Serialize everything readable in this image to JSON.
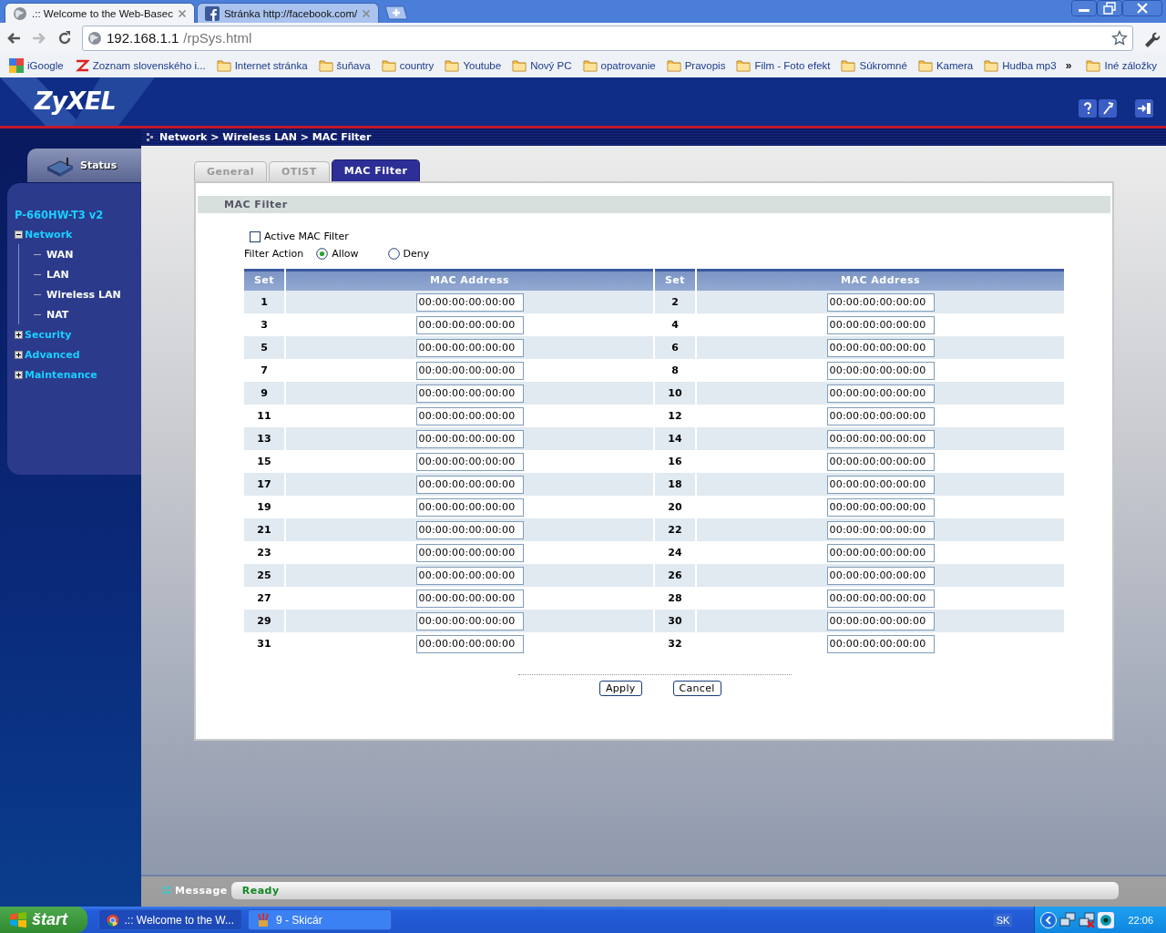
{
  "browser": {
    "tabs": [
      {
        "title": ".:: Welcome to the Web-Basec",
        "kind": "globe",
        "selected": true
      },
      {
        "title": "Stránka http://facebook.com/",
        "kind": "facebook",
        "selected": false
      }
    ],
    "address": {
      "host": "192.168.1.1",
      "path": "/rpSys.html"
    },
    "bookmarks": [
      {
        "label": "iGoogle",
        "kind": "google"
      },
      {
        "label": "Zoznam slovenského i...",
        "kind": "zoznam"
      },
      {
        "label": "Internet stránka",
        "kind": "folder"
      },
      {
        "label": "šuňava",
        "kind": "folder"
      },
      {
        "label": "country",
        "kind": "folder"
      },
      {
        "label": "Youtube",
        "kind": "folder"
      },
      {
        "label": "Nový PC",
        "kind": "folder"
      },
      {
        "label": "opatrovanie",
        "kind": "folder"
      },
      {
        "label": "Pravopis",
        "kind": "folder"
      },
      {
        "label": "Film - Foto efekt",
        "kind": "folder"
      },
      {
        "label": "Súkromné",
        "kind": "folder"
      },
      {
        "label": "Kamera",
        "kind": "folder"
      },
      {
        "label": "Hudba mp3",
        "kind": "folder"
      }
    ],
    "overflow": "»",
    "other_bookmarks": "Iné záložky"
  },
  "router": {
    "logo": "ZyXEL",
    "status_tab": "Status",
    "model": "P-660HW-T3 v2",
    "nav": [
      {
        "label": "Network",
        "expanded": true,
        "children": [
          {
            "label": "WAN"
          },
          {
            "label": "LAN"
          },
          {
            "label": "Wireless LAN"
          },
          {
            "label": "NAT"
          }
        ]
      },
      {
        "label": "Security",
        "expanded": false
      },
      {
        "label": "Advanced",
        "expanded": false
      },
      {
        "label": "Maintenance",
        "expanded": false
      }
    ],
    "breadcrumb": "Network > Wireless LAN > MAC Filter",
    "tabs": [
      {
        "label": "General",
        "selected": false
      },
      {
        "label": "OTIST",
        "selected": false
      },
      {
        "label": "MAC Filter",
        "selected": true
      }
    ],
    "section_title": "MAC Filter",
    "active_filter": {
      "label": "Active MAC Filter",
      "checked": false
    },
    "filter_action": {
      "label": "Filter Action",
      "options": [
        {
          "label": "Allow",
          "selected": true
        },
        {
          "label": "Deny",
          "selected": false
        }
      ]
    },
    "table": {
      "columns": [
        "Set",
        "MAC Address",
        "Set",
        "MAC Address"
      ],
      "rows": [
        [
          "1",
          "00:00:00:00:00:00",
          "2",
          "00:00:00:00:00:00"
        ],
        [
          "3",
          "00:00:00:00:00:00",
          "4",
          "00:00:00:00:00:00"
        ],
        [
          "5",
          "00:00:00:00:00:00",
          "6",
          "00:00:00:00:00:00"
        ],
        [
          "7",
          "00:00:00:00:00:00",
          "8",
          "00:00:00:00:00:00"
        ],
        [
          "9",
          "00:00:00:00:00:00",
          "10",
          "00:00:00:00:00:00"
        ],
        [
          "11",
          "00:00:00:00:00:00",
          "12",
          "00:00:00:00:00:00"
        ],
        [
          "13",
          "00:00:00:00:00:00",
          "14",
          "00:00:00:00:00:00"
        ],
        [
          "15",
          "00:00:00:00:00:00",
          "16",
          "00:00:00:00:00:00"
        ],
        [
          "17",
          "00:00:00:00:00:00",
          "18",
          "00:00:00:00:00:00"
        ],
        [
          "19",
          "00:00:00:00:00:00",
          "20",
          "00:00:00:00:00:00"
        ],
        [
          "21",
          "00:00:00:00:00:00",
          "22",
          "00:00:00:00:00:00"
        ],
        [
          "23",
          "00:00:00:00:00:00",
          "24",
          "00:00:00:00:00:00"
        ],
        [
          "25",
          "00:00:00:00:00:00",
          "26",
          "00:00:00:00:00:00"
        ],
        [
          "27",
          "00:00:00:00:00:00",
          "28",
          "00:00:00:00:00:00"
        ],
        [
          "29",
          "00:00:00:00:00:00",
          "30",
          "00:00:00:00:00:00"
        ],
        [
          "31",
          "00:00:00:00:00:00",
          "32",
          "00:00:00:00:00:00"
        ]
      ]
    },
    "buttons": [
      "Apply",
      "Cancel"
    ],
    "message": {
      "label": "Message",
      "text": "Ready"
    }
  },
  "taskbar": {
    "start": "štart",
    "tasks": [
      {
        "title": ".:: Welcome to the W...",
        "kind": "chrome",
        "selected": true
      },
      {
        "title": "9 - Skicár",
        "kind": "paint",
        "selected": false
      }
    ],
    "language": "SK",
    "clock": "22:06"
  }
}
